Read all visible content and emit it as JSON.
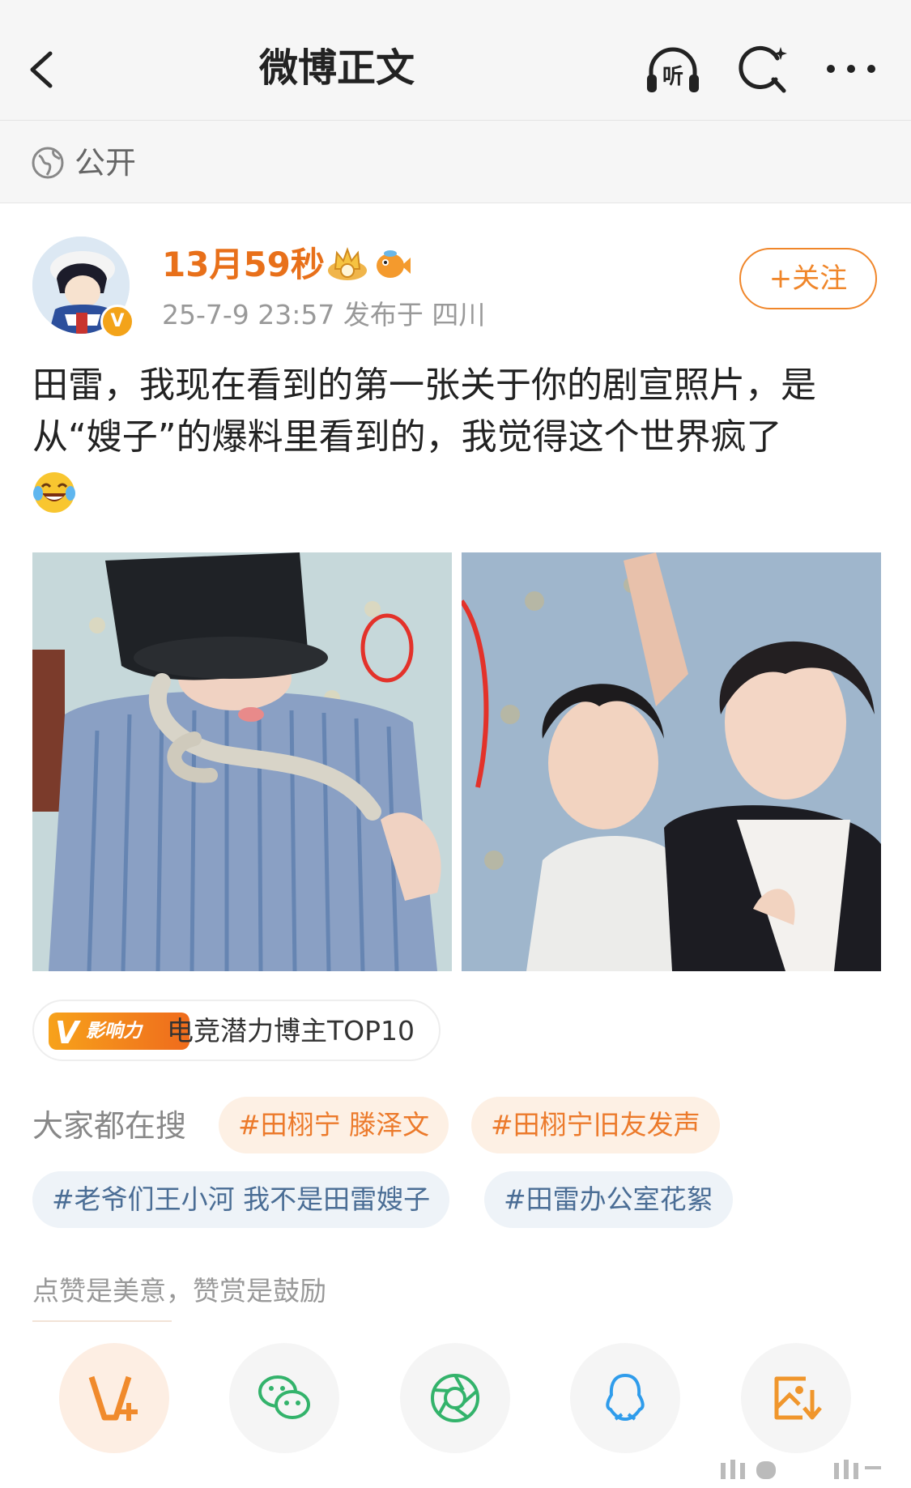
{
  "header": {
    "title": "微博正文",
    "listen_label": "听"
  },
  "visibility": {
    "label": "公开"
  },
  "post": {
    "author": "13月59秒",
    "verified_mark": "V",
    "meta": "25-7-9 23:57  发布于 四川",
    "follow_label": "+关注",
    "text": "田雷，我现在看到的第一张关于你的剧宣照片，是从“嫂子”的爆料里看到的，我觉得这个世界疯了"
  },
  "influence": {
    "logo_text": "影响力",
    "label": "电竞潜力博主TOP10"
  },
  "trending": {
    "label": "大家都在搜",
    "topics": [
      "#田栩宁 滕泽文",
      "#田栩宁旧友发声",
      "#老爷们王小河 我不是田雷嫂子",
      "#田雷办公室花絮"
    ]
  },
  "reward": {
    "text": "点赞是美意，赞赏是鼓励"
  },
  "share": {
    "icons": [
      "v-plus-icon",
      "wechat-icon",
      "moments-icon",
      "qq-icon",
      "save-image-icon"
    ]
  },
  "colors": {
    "accent": "#e8701a",
    "follow": "#f0862a",
    "topic_hot_bg": "#fdf0e4",
    "topic_blue_bg": "#eef3f8",
    "topic_blue_text": "#4a6d95"
  }
}
